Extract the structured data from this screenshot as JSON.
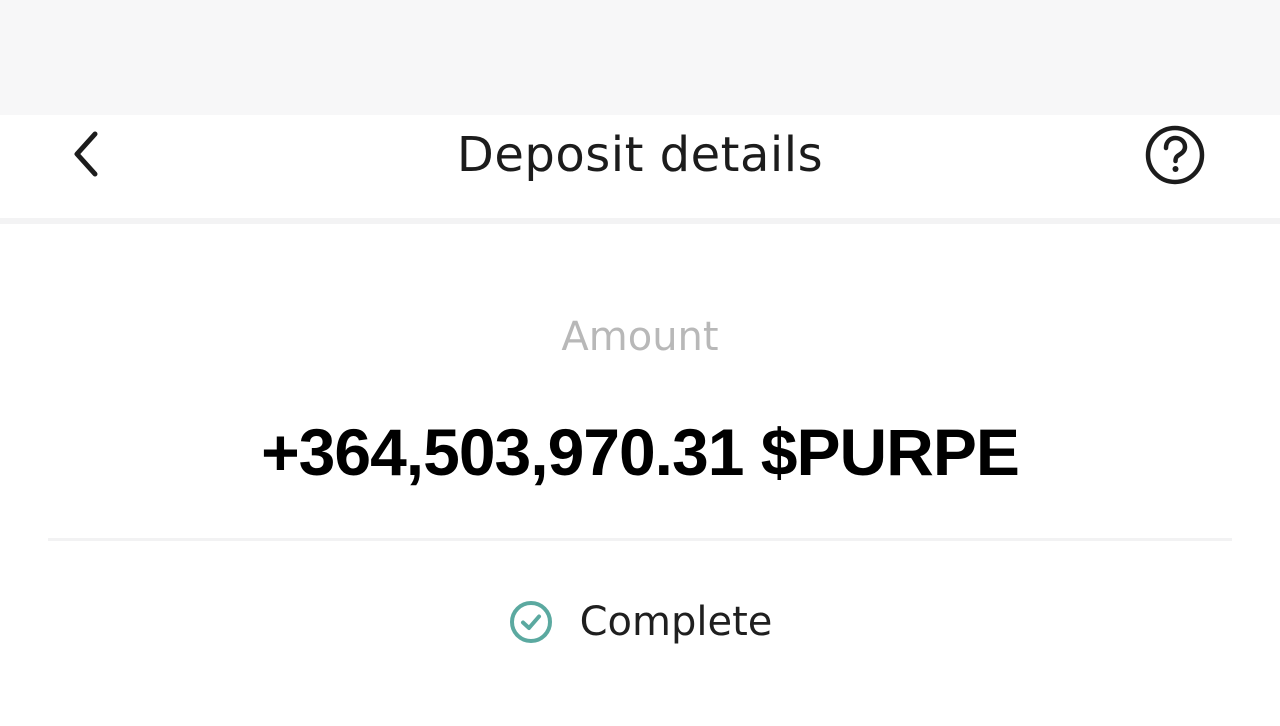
{
  "header": {
    "title": "Deposit details",
    "back_icon": "chevron-left-icon",
    "help_icon": "question-circle-icon"
  },
  "deposit": {
    "amount_label": "Amount",
    "amount_value": "+364,503,970.31 $PURPE",
    "status": "Complete",
    "status_icon": "check-circle-icon",
    "status_color": "#5ba9a0"
  },
  "colors": {
    "background": "#ffffff",
    "status_bar": "#f7f7f8",
    "label_gray": "#b8b8b8",
    "text_dark": "#1c1c1c"
  }
}
